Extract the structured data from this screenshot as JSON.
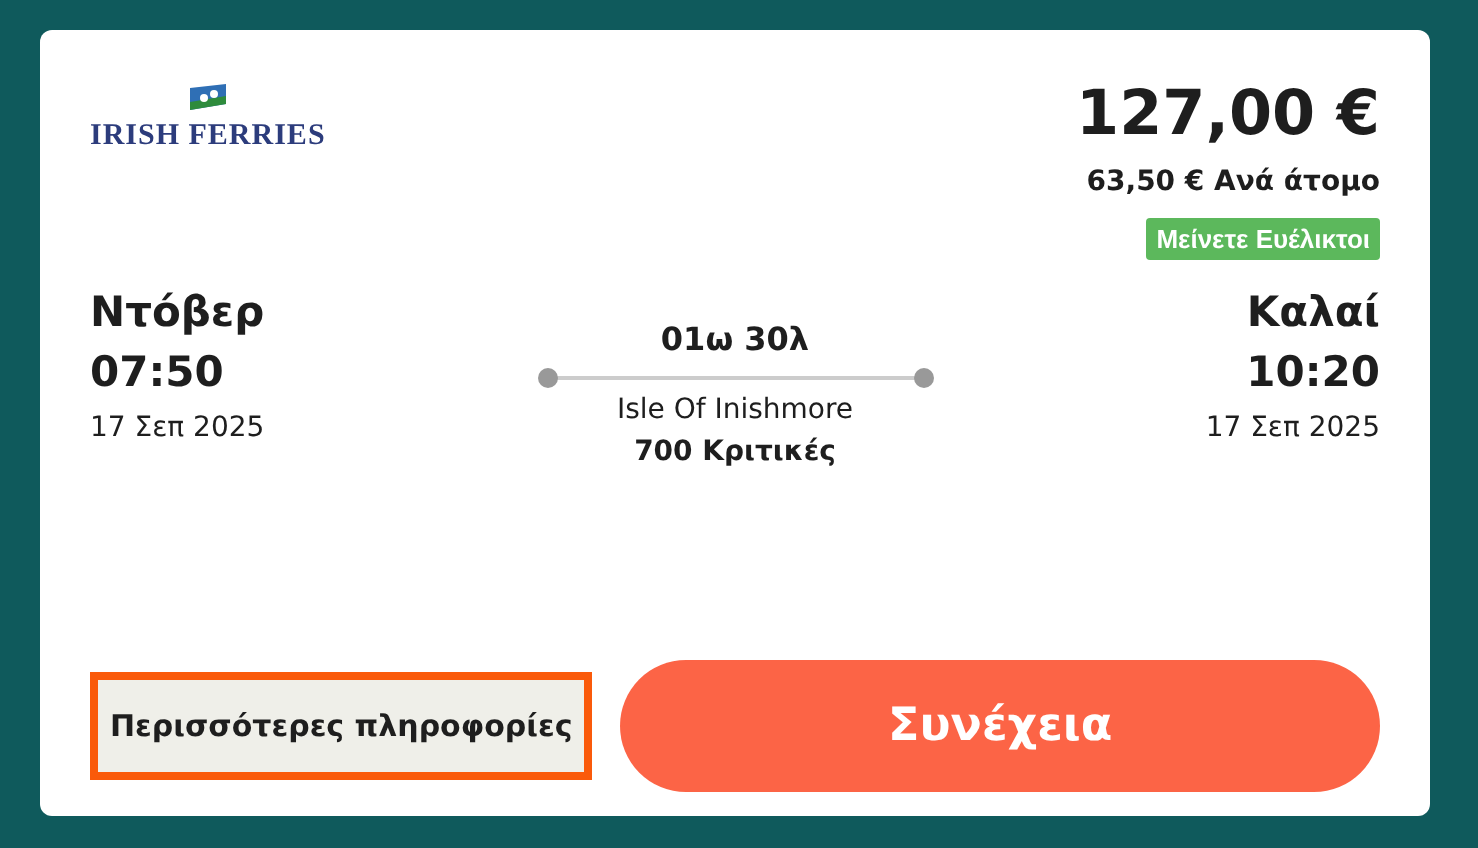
{
  "operator": {
    "logo_text": "IRISH FERRIES"
  },
  "price": {
    "total": "127,00 €",
    "per_person": "63,50 € Ανά άτομο",
    "badge": "Μείνετε Ευέλικτοι"
  },
  "departure": {
    "city": "Ντόβερ",
    "time": "07:50",
    "date": "17 Σεπ 2025"
  },
  "journey": {
    "duration": "01ω 30λ",
    "vessel": "Isle Of Inishmore",
    "reviews": "700 Κριτικές"
  },
  "arrival": {
    "city": "Καλαί",
    "time": "10:20",
    "date": "17 Σεπ 2025"
  },
  "buttons": [
    {
      "kind": "secondary",
      "label": "Περισσότερες πληροφορίες",
      "focused": true
    },
    {
      "kind": "primary",
      "label": "Συνέχεια",
      "focused": false
    }
  ]
}
